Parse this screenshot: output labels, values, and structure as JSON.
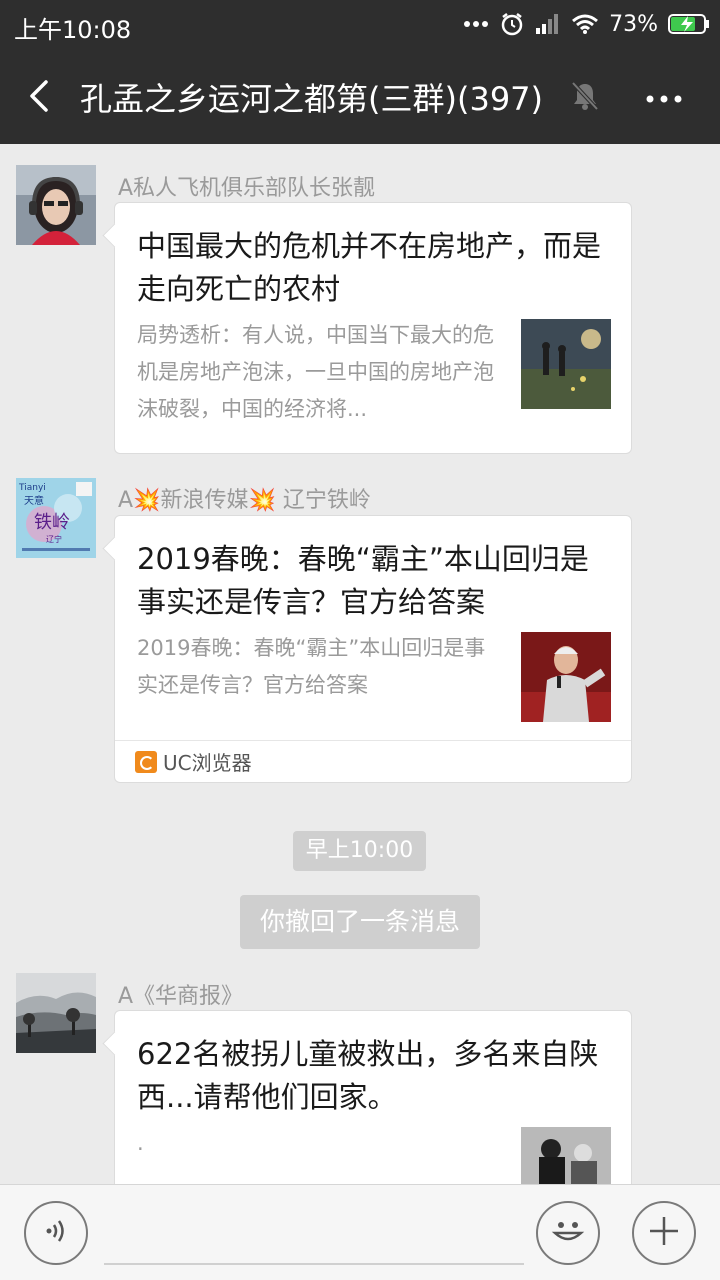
{
  "status_bar": {
    "time": "上午10:08",
    "battery_percent": "73%",
    "icons": [
      "more-dots-icon",
      "alarm-icon",
      "signal-icon",
      "wifi-icon",
      "battery-charging-icon"
    ]
  },
  "nav": {
    "title": "孔孟之乡运河之都第(三群)(397)",
    "icons": [
      "back-icon",
      "mute-icon",
      "more-icon"
    ]
  },
  "messages": [
    {
      "sender": "A私人飞机俱乐部队长张靓",
      "card_title": "中国最大的危机并不在房地产，而是走向死亡的农村",
      "card_desc": "局势透析：有人说，中国当下最大的危机是房地产泡沫，一旦中国的房地产泡沫破裂，中国的经济将..."
    },
    {
      "sender": "A💥新浪传媒💥 辽宁铁岭",
      "avatar_text": [
        "Tianyi",
        "天意",
        "铁岭",
        "辽宁"
      ],
      "card_title": "2019春晚：春晚“霸主”本山回归是事实还是传言？官方给答案",
      "card_desc": "2019春晚：春晚“霸主”本山回归是事实还是传言？官方给答案",
      "source": "UC浏览器"
    },
    {
      "sender": "A《华商报》",
      "card_title": "622名被拐儿童被救出，多名来自陕西...请帮他们回家。",
      "card_desc": "."
    }
  ],
  "system": {
    "timestamp": "早上10:00",
    "recall_notice": "你撤回了一条消息"
  },
  "input_bar": {
    "icons": [
      "voice-icon",
      "emoji-icon",
      "plus-icon"
    ]
  }
}
